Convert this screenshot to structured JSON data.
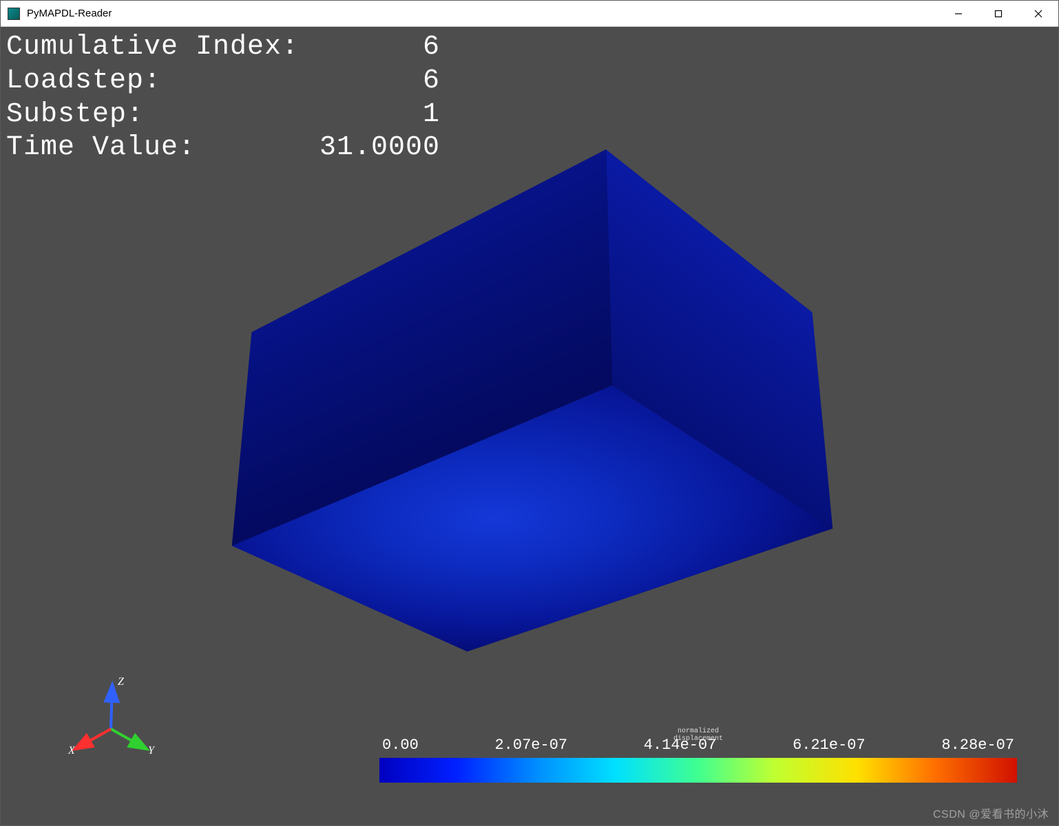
{
  "window": {
    "title": "PyMAPDL-Reader"
  },
  "info": {
    "cumulative_index_label": "Cumulative Index:",
    "cumulative_index_value": "6",
    "loadstep_label": "Loadstep:",
    "loadstep_value": "6",
    "substep_label": "Substep:",
    "substep_value": "1",
    "time_value_label": "Time Value:",
    "time_value_value": "31.0000"
  },
  "axes": {
    "x": "X",
    "y": "Y",
    "z": "Z"
  },
  "colorbar": {
    "title_line1": "normalized",
    "title_line2": "displacement",
    "ticks": [
      "0.00",
      "2.07e-07",
      "4.14e-07",
      "6.21e-07",
      "8.28e-07"
    ]
  },
  "watermark": "CSDN @爱看书的小沐",
  "chart_data": {
    "type": "heatmap",
    "title": "normalized displacement",
    "range": [
      0.0,
      8.28e-07
    ],
    "ticks": [
      0.0,
      2.07e-07,
      4.14e-07,
      6.21e-07,
      8.28e-07
    ],
    "colormap": "jet"
  }
}
